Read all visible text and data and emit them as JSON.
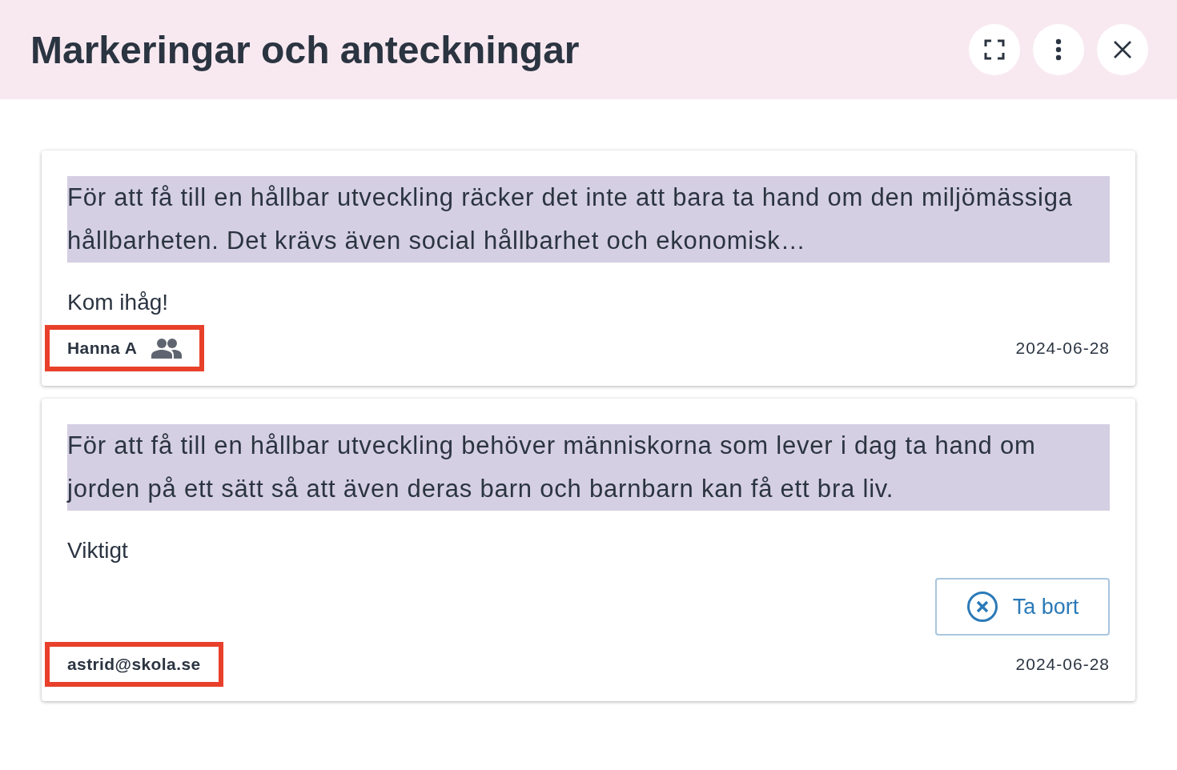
{
  "header": {
    "title": "Markeringar och anteckningar",
    "buttons": [
      {
        "kind": "fullscreen"
      },
      {
        "kind": "more"
      },
      {
        "kind": "close"
      }
    ]
  },
  "notes": [
    {
      "quote": "För att få till en hållbar utveckling räcker det inte att bara ta hand om den miljömässiga hållbarheten. Det krävs även social hållbarhet och ekonomisk…",
      "note": "Kom ihåg!",
      "author": "Hanna A",
      "shared": true,
      "highlighted": true,
      "date": "2024-06-28",
      "deletable": false
    },
    {
      "quote": "För att få till en hållbar utveckling behöver människorna som lever i dag ta hand om jorden på ett sätt så att även deras barn och barnbarn kan få ett bra liv.",
      "note": "Viktigt",
      "author": "astrid@skola.se",
      "shared": false,
      "highlighted": true,
      "date": "2024-06-28",
      "deletable": true,
      "delete_label": "Ta bort"
    }
  ]
}
